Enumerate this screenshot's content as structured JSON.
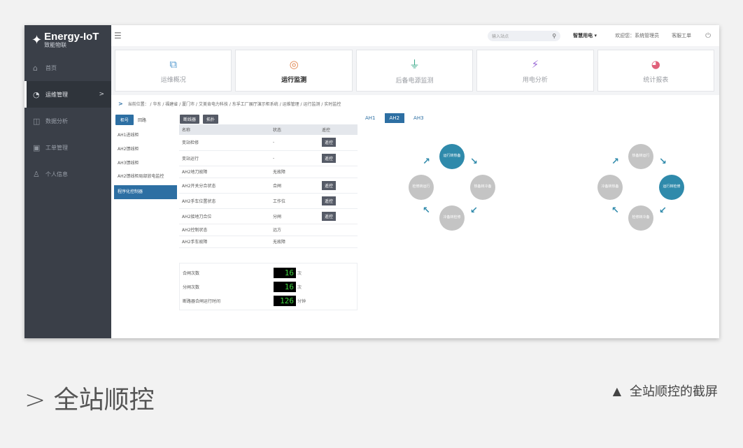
{
  "brand": {
    "title": "Energy-IoT",
    "subtitle": "致能物联"
  },
  "sidebar": {
    "items": [
      {
        "label": "首页",
        "icon": "home-icon"
      },
      {
        "label": "运维管理",
        "icon": "monitor-icon",
        "active": true
      },
      {
        "label": "数据分析",
        "icon": "database-icon"
      },
      {
        "label": "工单管理",
        "icon": "workorder-icon"
      },
      {
        "label": "个人信息",
        "icon": "user-icon"
      }
    ]
  },
  "topbar": {
    "search_placeholder": "输入站点",
    "select_label": "智慧用电 ▾",
    "welcome": "欢迎您：系统管理员",
    "service": "客服工单"
  },
  "cards": [
    {
      "label": "运维概况",
      "icon": "chart-icon"
    },
    {
      "label": "运行监测",
      "icon": "target-icon",
      "active": true
    },
    {
      "label": "后备电源监测",
      "icon": "plug-icon"
    },
    {
      "label": "用电分析",
      "icon": "bolt-icon"
    },
    {
      "label": "统计报表",
      "icon": "pie-icon"
    }
  ],
  "breadcrumb": "当前位置： / 华东 / 福建省 / 厦门市 / 艾美肯电力科技 / 东孚工厂展厅演示柜系统 / 运维管理 / 运行监测 / 实时监控",
  "left_tabs": {
    "active": "柜号",
    "other": "回路"
  },
  "feeders": [
    "AH1进线柜",
    "AH2馈线柜",
    "AH3馈线柜",
    "AH2馈线柜局部放电监控",
    "程序化控制器"
  ],
  "table_buttons": [
    "断线器",
    "拓扑"
  ],
  "table": {
    "headers": [
      "名称",
      "状态",
      "遥控"
    ],
    "rows": [
      {
        "name": "变站检修",
        "status": "-",
        "control": "遥控"
      },
      {
        "name": "变站运行",
        "status": "-",
        "control": "遥控"
      },
      {
        "name": "AH2地刀故障",
        "status": "无故障",
        "control": ""
      },
      {
        "name": "AH2开关分合状态",
        "status": "合闸",
        "control": "遥控"
      },
      {
        "name": "AH2手车位置状态",
        "status": "工作位",
        "control": "遥控"
      },
      {
        "name": "AH2接地刀合位",
        "status": "分闸",
        "control": "遥控"
      },
      {
        "name": "AH2控制状态",
        "status": "远方",
        "control": ""
      },
      {
        "name": "AH2手车故障",
        "status": "无故障",
        "control": ""
      }
    ]
  },
  "counters": [
    {
      "label": "合闸次数",
      "value": "16",
      "unit": "次"
    },
    {
      "label": "分闸次数",
      "value": "16",
      "unit": "次"
    },
    {
      "label": "断路器合闸运行时间",
      "value": "126",
      "unit": "分钟"
    }
  ],
  "ah_tabs": [
    "AH1",
    "AH2",
    "AH3"
  ],
  "ah_active": "AH2",
  "diagram1": {
    "top": "运行转热备",
    "left": "检修转运行",
    "right": "热备转冷备",
    "bottom": "冷备转检修",
    "active": "top"
  },
  "diagram2": {
    "top": "热备转运行",
    "left": "冷备转热备",
    "right": "运行转检修",
    "bottom": "检修转冷备",
    "active": "right"
  },
  "caption": {
    "left": "> 全站顺控",
    "right": "全站顺控的截屏"
  },
  "colors": {
    "accent": "#2d6fa3",
    "sidebar": "#3a3f48",
    "node_active": "#2f8aab",
    "node_idle": "#c4c4c4",
    "counter_digits": "#3ed13e"
  }
}
